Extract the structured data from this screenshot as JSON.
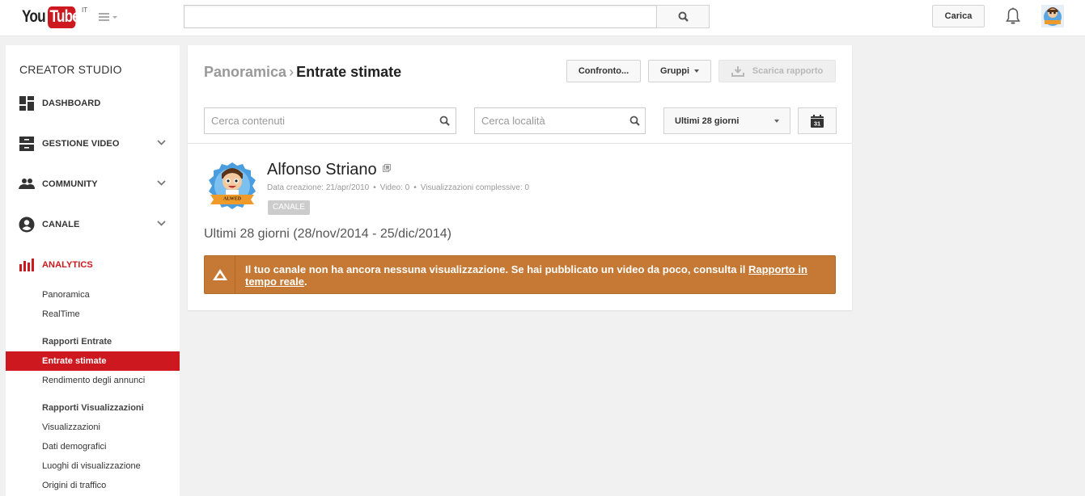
{
  "masthead": {
    "logo_you": "You",
    "logo_tube": "Tube",
    "logo_country": "IT",
    "search_value": "",
    "search_placeholder": "",
    "upload_label": "Carica"
  },
  "sidebar": {
    "title": "CREATOR STUDIO",
    "nav": [
      {
        "label": "DASHBOARD",
        "icon": "dashboard-icon",
        "expandable": false
      },
      {
        "label": "GESTIONE VIDEO",
        "icon": "video-manager-icon",
        "expandable": true
      },
      {
        "label": "COMMUNITY",
        "icon": "community-icon",
        "expandable": true
      },
      {
        "label": "CANALE",
        "icon": "channel-icon",
        "expandable": true
      },
      {
        "label": "ANALYTICS",
        "icon": "analytics-icon",
        "expandable": false,
        "active": true
      }
    ],
    "analytics_items": {
      "overview": "Panoramica",
      "realtime": "RealTime",
      "revenue_header": "Rapporti Entrate",
      "estimated_revenue": "Entrate stimate",
      "ad_performance": "Rendimento degli annunci",
      "views_header": "Rapporti Visualizzazioni",
      "views": "Visualizzazioni",
      "demographics": "Dati demografici",
      "playback_locations": "Luoghi di visualizzazione",
      "traffic_sources": "Origini di traffico"
    }
  },
  "main": {
    "breadcrumb_parent": "Panoramica",
    "breadcrumb_separator": "›",
    "breadcrumb_current": "Entrate stimate",
    "compare_label": "Confronto...",
    "groups_label": "Gruppi",
    "download_label": "Scarica rapporto",
    "search_content_placeholder": "Cerca contenuti",
    "search_location_placeholder": "Cerca località",
    "date_range_selected": "Ultimi 28 giorni",
    "calendar_day": "31",
    "channel": {
      "name": "Alfonso Striano",
      "created": "Data creazione: 21/apr/2010",
      "videos": "Video: 0",
      "total_views": "Visualizzazioni complessive: 0",
      "badge": "CANALE",
      "avatar_text": "ALWED"
    },
    "period_text": "Ultimi 28 giorni (28/nov/2014 - 25/dic/2014)",
    "alert": {
      "text": "Il tuo canale non ha ancora nessuna visualizzazione. Se hai pubblicato un video da poco, consulta il ",
      "link_text": "Rapporto in tempo reale",
      "suffix": ".",
      "color": "#c57935"
    }
  },
  "colors": {
    "brand_red": "#cc181e",
    "alert_orange": "#c57935"
  }
}
